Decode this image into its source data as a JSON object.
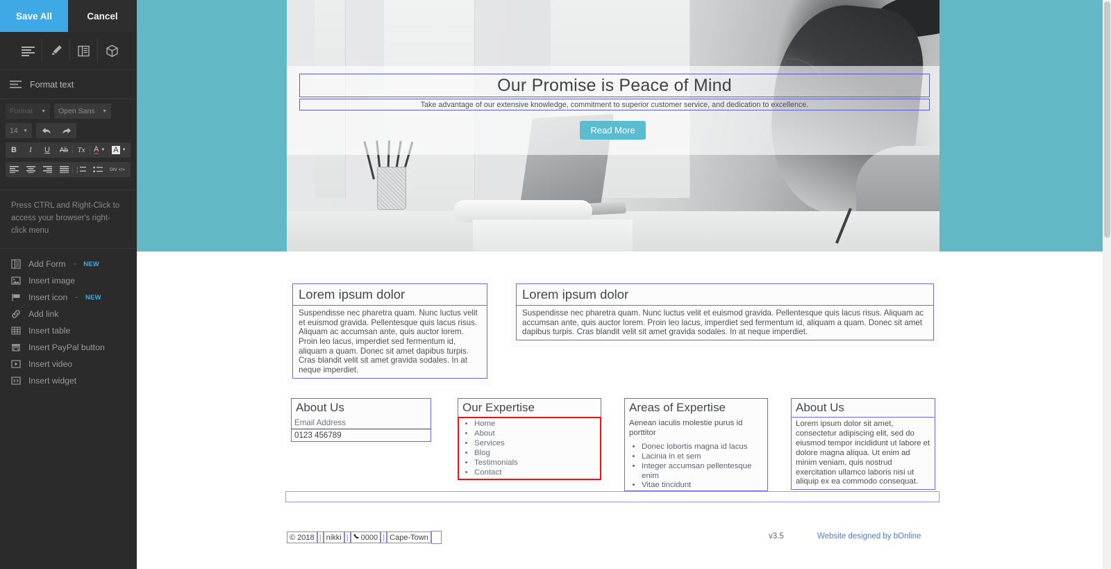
{
  "sidebar": {
    "save_label": "Save All",
    "cancel_label": "Cancel",
    "tools": [
      {
        "name": "text-lines-icon",
        "title": "Format text"
      },
      {
        "name": "pencil-icon",
        "title": "Design"
      },
      {
        "name": "layout-columns-icon",
        "title": "Layout"
      },
      {
        "name": "box-3d-icon",
        "title": "Widgets"
      }
    ],
    "section_title": "Format text",
    "format": {
      "paragraph_select": "Format",
      "font_select": "Open Sans",
      "size_select": "14",
      "undo_icon": "undo-arrow-icon",
      "redo_icon": "redo-arrow-icon",
      "bold": "B",
      "italic": "I",
      "underline": "U",
      "strikethrough": "Ab",
      "clear_format": "Tx",
      "font_color": "A",
      "highlight_color": "A",
      "align_left": "align-left-icon",
      "align_center": "align-center-icon",
      "align_right": "align-right-icon",
      "align_justify": "align-justify-icon",
      "ordered_list": "ordered-list-icon",
      "unordered_list": "unordered-list-icon",
      "code_label": "DIV </>"
    },
    "hint": "Press CTRL and Right-Click to access your browser's right-click menu",
    "items": [
      {
        "label": "Add Form",
        "badge": "NEW",
        "icon": "form-icon"
      },
      {
        "label": "Insert image",
        "badge": "",
        "icon": "image-icon"
      },
      {
        "label": "Insert icon",
        "badge": "NEW",
        "icon": "flag-icon"
      },
      {
        "label": "Add link",
        "badge": "",
        "icon": "link-icon"
      },
      {
        "label": "Insert table",
        "badge": "",
        "icon": "table-icon"
      },
      {
        "label": "Insert PayPal button",
        "badge": "",
        "icon": "paypal-icon"
      },
      {
        "label": "Insert video",
        "badge": "",
        "icon": "video-icon"
      },
      {
        "label": "Insert widget",
        "badge": "",
        "icon": "widget-code-icon"
      }
    ],
    "badge_dash": "-"
  },
  "hero": {
    "heading": "Our Promise is Peace of Mind",
    "subheading": "Take advantage of our extensive knowledge, commitment to superior customer service, and dedication to excellence.",
    "button_label": "Read More",
    "band_color": "#63b8c6",
    "button_color": "#5bbcd0"
  },
  "two_column": {
    "left": {
      "heading": "Lorem ipsum dolor",
      "body": "Suspendisse nec pharetra quam. Nunc luctus velit et euismod gravida. Pellentesque quis lacus risus. Aliquam ac accumsan ante, quis auctor lorem. Proin leo lacus, imperdiet sed fermentum id, aliquam a quam. Donec sit amet dapibus turpis. Cras blandit velit sit amet gravida sodales. In at neque imperdiet."
    },
    "right": {
      "heading": "Lorem ipsum dolor",
      "body": "Suspendisse nec pharetra quam. Nunc luctus velit et euismod gravida. Pellentesque quis lacus risus. Aliquam ac accumsan ante, quis auctor lorem. Proin leo lacus, imperdiet sed fermentum id, aliquam a quam. Donec sit amet dapibus turpis. Cras blandit velit sit amet gravida sodales. In at neque imperdiet."
    }
  },
  "footer_columns": [
    {
      "heading": "About Us",
      "email_placeholder": "Email Address",
      "phone": "0123 456789"
    },
    {
      "heading": "Our Expertise",
      "links": [
        "Home",
        "About",
        "Services",
        "Blog",
        "Testimonials",
        "Contact"
      ],
      "selected_outline_color": "#ee1111"
    },
    {
      "heading": "Areas of Expertise",
      "intro": "Aenean iaculis molestie purus id porttitor",
      "items": [
        "Donec lobortis magna id lacus",
        "Lacinia in et sem",
        "Integer accumsan pellentesque enim",
        "Vitae tincidunt"
      ]
    },
    {
      "heading": "About Us",
      "body": "Lorem ipsum dolor sit amet, consectetur adipiscing elit, sed do eiusmod tempor incididunt ut labore et dolore magna aliqua. Ut enim ad minim veniam, quis nostrud exercitation ullamco laboris nisi ut aliquip ex ea commodo consequat."
    }
  ],
  "bottom": {
    "copyright": "© 2018",
    "sep1": "|",
    "company": "nikki",
    "sep2": "|",
    "phone_icon": "phone-icon",
    "phone": "0000",
    "sep3": "|",
    "city": "Cape-Town",
    "version": "v3.5",
    "credit": "Website designed by bOnline"
  }
}
